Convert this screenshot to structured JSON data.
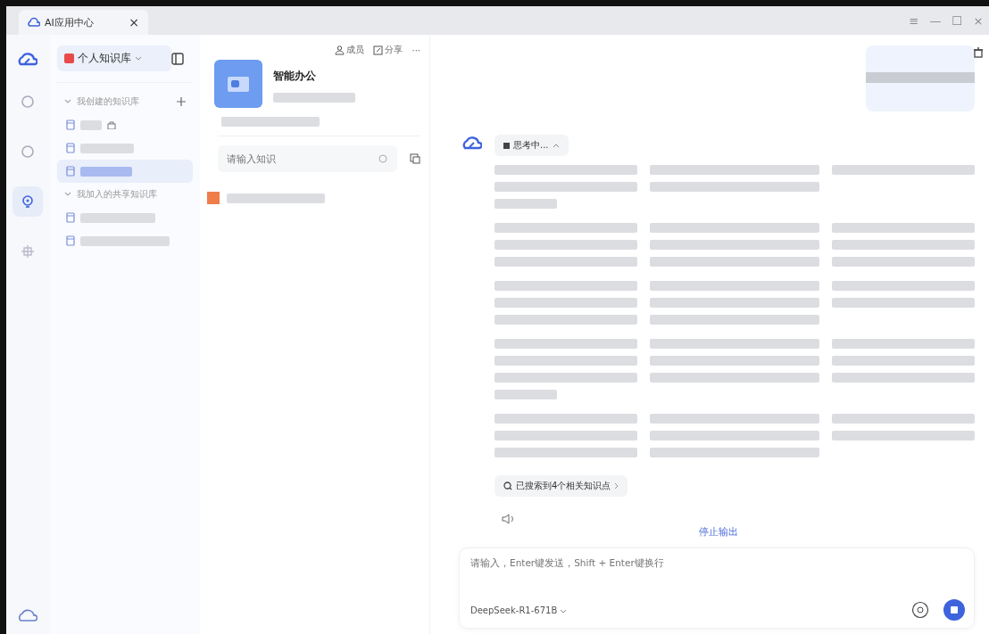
{
  "tab": {
    "title": "AI应用中心",
    "close": "×"
  },
  "window_controls": [
    "≡",
    "—",
    "☐",
    "×"
  ],
  "rail": [
    {
      "selected": false
    },
    {
      "selected": false
    },
    {
      "selected": true
    },
    {
      "selected": false
    }
  ],
  "library_switcher": {
    "label": "个人知识库"
  },
  "groups": [
    {
      "title": "我创建的知识库",
      "expanded": true,
      "items": [
        {
          "selected": false,
          "locked": true
        },
        {
          "selected": false,
          "locked": false
        },
        {
          "selected": true,
          "locked": false
        }
      ]
    },
    {
      "title": "我加入的共享知识库",
      "expanded": true,
      "items": [
        {
          "selected": false,
          "locked": false
        },
        {
          "selected": false,
          "locked": false
        }
      ]
    }
  ],
  "kb": {
    "actions": [
      "成员",
      "分享"
    ],
    "more": "···",
    "title": "智能办公",
    "search_placeholder": "请输入知识"
  },
  "chat": {
    "thinking": "思考中...",
    "sources": "已搜索到4个相关知识点",
    "stop": "停止输出",
    "input_placeholder": "请输入，Enter键发送，Shift + Enter键换行",
    "model": "DeepSeek-R1-671B"
  }
}
